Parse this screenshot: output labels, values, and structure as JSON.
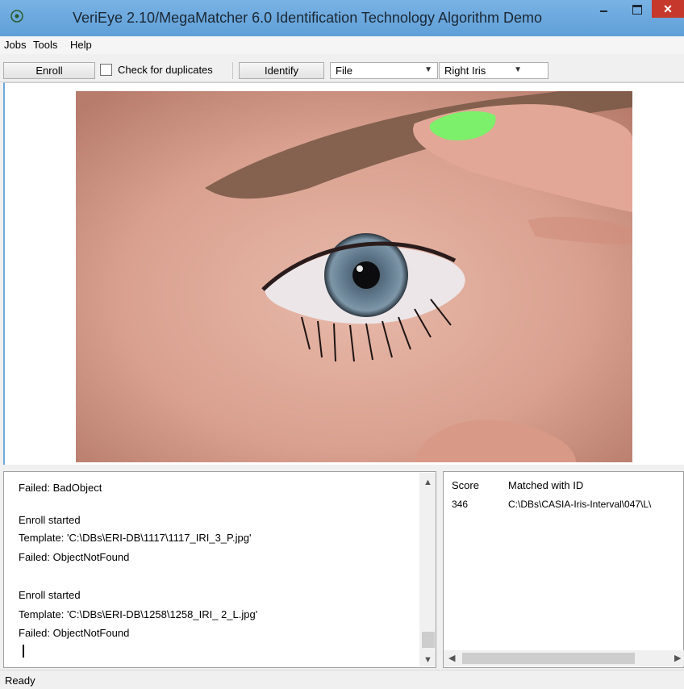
{
  "window": {
    "title": "VeriEye 2.10/MegaMatcher 6.0 Identification Technology Algorithm Demo",
    "close_glyph": "✕"
  },
  "menu": [
    "Jobs",
    "Tools",
    "Help"
  ],
  "toolbar": {
    "enroll_label": "Enroll",
    "check_duplicates_label": "Check for duplicates",
    "check_duplicates_checked": false,
    "identify_label": "Identify",
    "source_select": "File",
    "iris_select": "Right Iris"
  },
  "log": [
    "Failed: BadObject",
    "",
    "Enroll started",
    "Template: 'C:\\DBs\\ERI-DB\\1117\\1117_IRI_3_P.jpg'",
    "Failed: ObjectNotFound",
    "",
    "Enroll started",
    "Template: 'C:\\DBs\\ERI-DB\\1258\\1258_IRI_ 2_L.jpg'",
    "Failed: ObjectNotFound"
  ],
  "results": {
    "headers": [
      "Score",
      "Matched with ID"
    ],
    "rows": [
      [
        "346",
        "C:\\DBs\\CASIA-Iris-Interval\\047\\L\\"
      ]
    ]
  },
  "status": "Ready",
  "icons": {
    "app": "app-icon",
    "min": "minimize-icon",
    "max": "maximize-icon",
    "close": "close-icon"
  },
  "colors": {
    "titlebar": "#6fa8dc",
    "close": "#c7382c"
  }
}
